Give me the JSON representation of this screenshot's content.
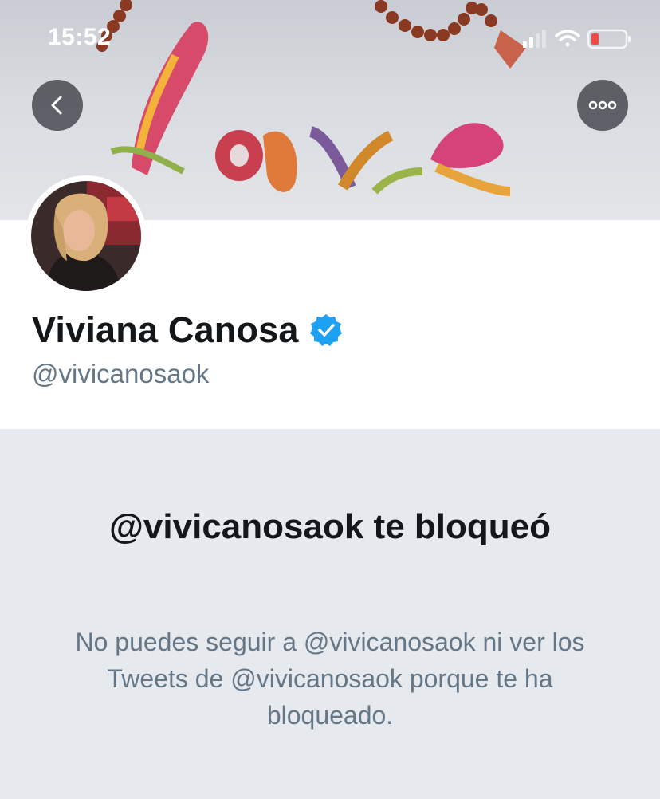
{
  "status_bar": {
    "time": "15:52"
  },
  "header": {
    "back_icon": "chevron-left-icon",
    "more_icon": "ellipsis-icon",
    "banner_word": "love"
  },
  "profile": {
    "display_name": "Viviana Canosa",
    "verified": true,
    "handle": "@vivicanosaok"
  },
  "blocked": {
    "title": "@vivicanosaok te bloqueó",
    "message": "No puedes seguir a @vivicanosaok ni ver los Tweets de @vivicanosaok porque te ha bloqueado."
  },
  "colors": {
    "verified_blue": "#1da1f2",
    "text_primary": "#14171a",
    "text_secondary": "#657786",
    "blocked_bg": "#e6e9ee",
    "battery_low": "#f04a45"
  }
}
